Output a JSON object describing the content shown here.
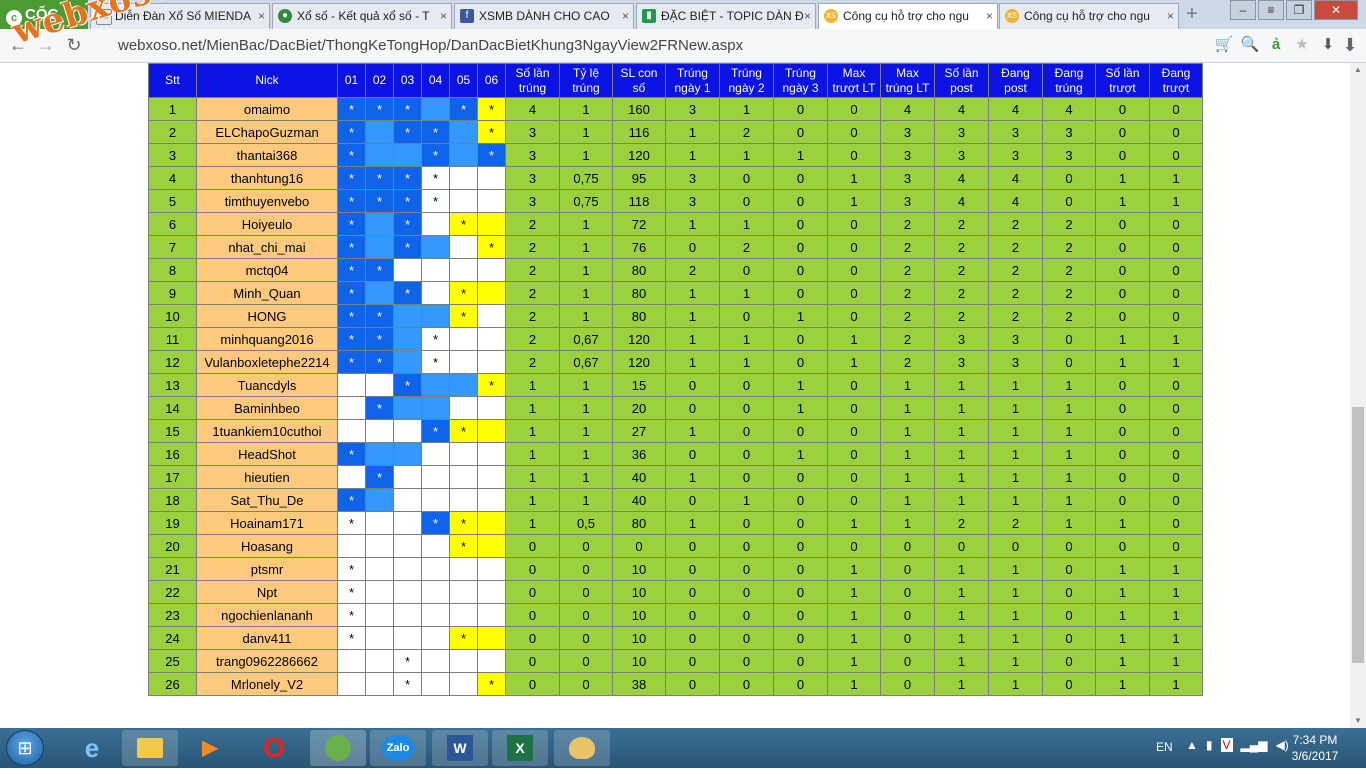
{
  "browser": {
    "brand": "CỐC CỐC",
    "tabs": [
      {
        "label": "Diễn Đàn Xổ Số MIENDA",
        "icon": "page-icon",
        "active": false
      },
      {
        "label": "Xổ số - Kết quả xổ số - T",
        "icon": "lottery-icon",
        "active": false
      },
      {
        "label": "XSMB DÀNH CHO CAO",
        "icon": "facebook-icon",
        "active": false
      },
      {
        "label": "ĐẶC BIỆT - TOPIC DÀN Đ",
        "icon": "doc-icon",
        "active": false
      },
      {
        "label": "Công cụ hỗ trợ cho ngu",
        "icon": "xs-icon",
        "active": true
      },
      {
        "label": "Công cụ hỗ trợ cho ngu",
        "icon": "xs-icon",
        "active": false
      }
    ],
    "url": "webxoso.net/MienBac/DacBiet/ThongKeTongHop/DanDacBietKhung3NgayView2FRNew.aspx"
  },
  "watermark": "webxoso.net",
  "table": {
    "headers": [
      "Stt",
      "Nick",
      "01",
      "02",
      "03",
      "04",
      "05",
      "06",
      "Số lần trúng",
      "Tỷ lệ trúng",
      "SL con số",
      "Trúng ngày 1",
      "Trúng ngày 2",
      "Trúng ngày 3",
      "Max trượt LT",
      "Max trúng LT",
      "Số lần post",
      "Đang post",
      "Đang trúng",
      "Số lần trượt",
      "Đang trượt"
    ],
    "day_cell_colors": {
      "db": "#0f63e9",
      "lb": "#3399ff",
      "yl": "#ffff00",
      "wh": "#ffffff"
    },
    "rows": [
      {
        "stt": "1",
        "nick": "omaimo",
        "days": [
          [
            "db",
            "*"
          ],
          [
            "db",
            "*"
          ],
          [
            "db",
            "*"
          ],
          [
            "lb",
            ""
          ],
          [
            "db",
            "*"
          ],
          [
            "yl",
            "*"
          ]
        ],
        "vals": [
          "4",
          "1",
          "160",
          "3",
          "1",
          "0",
          "0",
          "4",
          "4",
          "4",
          "4",
          "0",
          "0"
        ]
      },
      {
        "stt": "2",
        "nick": "ELChapoGuzman",
        "days": [
          [
            "db",
            "*"
          ],
          [
            "lb",
            ""
          ],
          [
            "db",
            "*"
          ],
          [
            "db",
            "*"
          ],
          [
            "lb",
            ""
          ],
          [
            "yl",
            "*"
          ]
        ],
        "vals": [
          "3",
          "1",
          "116",
          "1",
          "2",
          "0",
          "0",
          "3",
          "3",
          "3",
          "3",
          "0",
          "0"
        ]
      },
      {
        "stt": "3",
        "nick": "thantai368",
        "days": [
          [
            "db",
            "*"
          ],
          [
            "lb",
            ""
          ],
          [
            "lb",
            ""
          ],
          [
            "db",
            "*"
          ],
          [
            "lb",
            ""
          ],
          [
            "db",
            "*"
          ]
        ],
        "vals": [
          "3",
          "1",
          "120",
          "1",
          "1",
          "1",
          "0",
          "3",
          "3",
          "3",
          "3",
          "0",
          "0"
        ]
      },
      {
        "stt": "4",
        "nick": "thanhtung16",
        "days": [
          [
            "db",
            "*"
          ],
          [
            "db",
            "*"
          ],
          [
            "db",
            "*"
          ],
          [
            "wh",
            "*"
          ],
          [
            "wh",
            ""
          ],
          [
            "wh",
            ""
          ]
        ],
        "vals": [
          "3",
          "0,75",
          "95",
          "3",
          "0",
          "0",
          "1",
          "3",
          "4",
          "4",
          "0",
          "1",
          "1"
        ]
      },
      {
        "stt": "5",
        "nick": "timthuyenvebo",
        "days": [
          [
            "db",
            "*"
          ],
          [
            "db",
            "*"
          ],
          [
            "db",
            "*"
          ],
          [
            "wh",
            "*"
          ],
          [
            "wh",
            ""
          ],
          [
            "wh",
            ""
          ]
        ],
        "vals": [
          "3",
          "0,75",
          "118",
          "3",
          "0",
          "0",
          "1",
          "3",
          "4",
          "4",
          "0",
          "1",
          "1"
        ]
      },
      {
        "stt": "6",
        "nick": "Hoiyeulo",
        "days": [
          [
            "db",
            "*"
          ],
          [
            "lb",
            ""
          ],
          [
            "db",
            "*"
          ],
          [
            "wh",
            ""
          ],
          [
            "yl",
            "*"
          ],
          [
            "yl",
            ""
          ]
        ],
        "vals": [
          "2",
          "1",
          "72",
          "1",
          "1",
          "0",
          "0",
          "2",
          "2",
          "2",
          "2",
          "0",
          "0"
        ]
      },
      {
        "stt": "7",
        "nick": "nhat_chi_mai",
        "days": [
          [
            "db",
            "*"
          ],
          [
            "lb",
            ""
          ],
          [
            "db",
            "*"
          ],
          [
            "lb",
            ""
          ],
          [
            "wh",
            ""
          ],
          [
            "yl",
            "*"
          ]
        ],
        "vals": [
          "2",
          "1",
          "76",
          "0",
          "2",
          "0",
          "0",
          "2",
          "2",
          "2",
          "2",
          "0",
          "0"
        ]
      },
      {
        "stt": "8",
        "nick": "mctq04",
        "days": [
          [
            "db",
            "*"
          ],
          [
            "db",
            "*"
          ],
          [
            "wh",
            ""
          ],
          [
            "wh",
            ""
          ],
          [
            "wh",
            ""
          ],
          [
            "wh",
            ""
          ]
        ],
        "vals": [
          "2",
          "1",
          "80",
          "2",
          "0",
          "0",
          "0",
          "2",
          "2",
          "2",
          "2",
          "0",
          "0"
        ]
      },
      {
        "stt": "9",
        "nick": "Minh_Quan",
        "days": [
          [
            "db",
            "*"
          ],
          [
            "lb",
            ""
          ],
          [
            "db",
            "*"
          ],
          [
            "wh",
            ""
          ],
          [
            "yl",
            "*"
          ],
          [
            "yl",
            ""
          ]
        ],
        "vals": [
          "2",
          "1",
          "80",
          "1",
          "1",
          "0",
          "0",
          "2",
          "2",
          "2",
          "2",
          "0",
          "0"
        ]
      },
      {
        "stt": "10",
        "nick": "HONG",
        "days": [
          [
            "db",
            "*"
          ],
          [
            "db",
            "*"
          ],
          [
            "lb",
            ""
          ],
          [
            "lb",
            ""
          ],
          [
            "yl",
            "*"
          ],
          [
            "wh",
            ""
          ]
        ],
        "vals": [
          "2",
          "1",
          "80",
          "1",
          "0",
          "1",
          "0",
          "2",
          "2",
          "2",
          "2",
          "0",
          "0"
        ]
      },
      {
        "stt": "11",
        "nick": "minhquang2016",
        "days": [
          [
            "db",
            "*"
          ],
          [
            "db",
            "*"
          ],
          [
            "lb",
            ""
          ],
          [
            "wh",
            "*"
          ],
          [
            "wh",
            ""
          ],
          [
            "wh",
            ""
          ]
        ],
        "vals": [
          "2",
          "0,67",
          "120",
          "1",
          "1",
          "0",
          "1",
          "2",
          "3",
          "3",
          "0",
          "1",
          "1"
        ]
      },
      {
        "stt": "12",
        "nick": "Vulanboxletephe2214",
        "days": [
          [
            "db",
            "*"
          ],
          [
            "db",
            "*"
          ],
          [
            "lb",
            ""
          ],
          [
            "wh",
            "*"
          ],
          [
            "wh",
            ""
          ],
          [
            "wh",
            ""
          ]
        ],
        "vals": [
          "2",
          "0,67",
          "120",
          "1",
          "1",
          "0",
          "1",
          "2",
          "3",
          "3",
          "0",
          "1",
          "1"
        ]
      },
      {
        "stt": "13",
        "nick": "Tuancdyls",
        "days": [
          [
            "wh",
            ""
          ],
          [
            "wh",
            ""
          ],
          [
            "db",
            "*"
          ],
          [
            "lb",
            ""
          ],
          [
            "lb",
            ""
          ],
          [
            "yl",
            "*"
          ]
        ],
        "vals": [
          "1",
          "1",
          "15",
          "0",
          "0",
          "1",
          "0",
          "1",
          "1",
          "1",
          "1",
          "0",
          "0"
        ]
      },
      {
        "stt": "14",
        "nick": "Baminhbeo",
        "days": [
          [
            "wh",
            ""
          ],
          [
            "db",
            "*"
          ],
          [
            "lb",
            ""
          ],
          [
            "lb",
            ""
          ],
          [
            "wh",
            ""
          ],
          [
            "wh",
            ""
          ]
        ],
        "vals": [
          "1",
          "1",
          "20",
          "0",
          "0",
          "1",
          "0",
          "1",
          "1",
          "1",
          "1",
          "0",
          "0"
        ]
      },
      {
        "stt": "15",
        "nick": "1tuankiem10cuthoi",
        "days": [
          [
            "wh",
            ""
          ],
          [
            "wh",
            ""
          ],
          [
            "wh",
            ""
          ],
          [
            "db",
            "*"
          ],
          [
            "yl",
            "*"
          ],
          [
            "yl",
            ""
          ]
        ],
        "vals": [
          "1",
          "1",
          "27",
          "1",
          "0",
          "0",
          "0",
          "1",
          "1",
          "1",
          "1",
          "0",
          "0"
        ]
      },
      {
        "stt": "16",
        "nick": "HeadShot",
        "days": [
          [
            "db",
            "*"
          ],
          [
            "lb",
            ""
          ],
          [
            "lb",
            ""
          ],
          [
            "wh",
            ""
          ],
          [
            "wh",
            ""
          ],
          [
            "wh",
            ""
          ]
        ],
        "vals": [
          "1",
          "1",
          "36",
          "0",
          "0",
          "1",
          "0",
          "1",
          "1",
          "1",
          "1",
          "0",
          "0"
        ]
      },
      {
        "stt": "17",
        "nick": "hieutien",
        "days": [
          [
            "wh",
            ""
          ],
          [
            "db",
            "*"
          ],
          [
            "wh",
            ""
          ],
          [
            "wh",
            ""
          ],
          [
            "wh",
            ""
          ],
          [
            "wh",
            ""
          ]
        ],
        "vals": [
          "1",
          "1",
          "40",
          "1",
          "0",
          "0",
          "0",
          "1",
          "1",
          "1",
          "1",
          "0",
          "0"
        ]
      },
      {
        "stt": "18",
        "nick": "Sat_Thu_De",
        "days": [
          [
            "db",
            "*"
          ],
          [
            "lb",
            ""
          ],
          [
            "wh",
            ""
          ],
          [
            "wh",
            ""
          ],
          [
            "wh",
            ""
          ],
          [
            "wh",
            ""
          ]
        ],
        "vals": [
          "1",
          "1",
          "40",
          "0",
          "1",
          "0",
          "0",
          "1",
          "1",
          "1",
          "1",
          "0",
          "0"
        ]
      },
      {
        "stt": "19",
        "nick": "Hoainam171",
        "days": [
          [
            "wh",
            "*"
          ],
          [
            "wh",
            ""
          ],
          [
            "wh",
            ""
          ],
          [
            "db",
            "*"
          ],
          [
            "yl",
            "*"
          ],
          [
            "yl",
            ""
          ]
        ],
        "vals": [
          "1",
          "0,5",
          "80",
          "1",
          "0",
          "0",
          "1",
          "1",
          "2",
          "2",
          "1",
          "1",
          "0"
        ]
      },
      {
        "stt": "20",
        "nick": "Hoasang",
        "days": [
          [
            "wh",
            ""
          ],
          [
            "wh",
            ""
          ],
          [
            "wh",
            ""
          ],
          [
            "wh",
            ""
          ],
          [
            "yl",
            "*"
          ],
          [
            "yl",
            ""
          ]
        ],
        "vals": [
          "0",
          "0",
          "0",
          "0",
          "0",
          "0",
          "0",
          "0",
          "0",
          "0",
          "0",
          "0",
          "0"
        ]
      },
      {
        "stt": "21",
        "nick": "ptsmr",
        "days": [
          [
            "wh",
            "*"
          ],
          [
            "wh",
            ""
          ],
          [
            "wh",
            ""
          ],
          [
            "wh",
            ""
          ],
          [
            "wh",
            ""
          ],
          [
            "wh",
            ""
          ]
        ],
        "vals": [
          "0",
          "0",
          "10",
          "0",
          "0",
          "0",
          "1",
          "0",
          "1",
          "1",
          "0",
          "1",
          "1"
        ]
      },
      {
        "stt": "22",
        "nick": "Npt",
        "days": [
          [
            "wh",
            "*"
          ],
          [
            "wh",
            ""
          ],
          [
            "wh",
            ""
          ],
          [
            "wh",
            ""
          ],
          [
            "wh",
            ""
          ],
          [
            "wh",
            ""
          ]
        ],
        "vals": [
          "0",
          "0",
          "10",
          "0",
          "0",
          "0",
          "1",
          "0",
          "1",
          "1",
          "0",
          "1",
          "1"
        ]
      },
      {
        "stt": "23",
        "nick": "ngochienlananh",
        "days": [
          [
            "wh",
            "*"
          ],
          [
            "wh",
            ""
          ],
          [
            "wh",
            ""
          ],
          [
            "wh",
            ""
          ],
          [
            "wh",
            ""
          ],
          [
            "wh",
            ""
          ]
        ],
        "vals": [
          "0",
          "0",
          "10",
          "0",
          "0",
          "0",
          "1",
          "0",
          "1",
          "1",
          "0",
          "1",
          "1"
        ]
      },
      {
        "stt": "24",
        "nick": "danv411",
        "days": [
          [
            "wh",
            "*"
          ],
          [
            "wh",
            ""
          ],
          [
            "wh",
            ""
          ],
          [
            "wh",
            ""
          ],
          [
            "yl",
            "*"
          ],
          [
            "yl",
            ""
          ]
        ],
        "vals": [
          "0",
          "0",
          "10",
          "0",
          "0",
          "0",
          "1",
          "0",
          "1",
          "1",
          "0",
          "1",
          "1"
        ]
      },
      {
        "stt": "25",
        "nick": "trang0962286662",
        "days": [
          [
            "wh",
            ""
          ],
          [
            "wh",
            ""
          ],
          [
            "wh",
            "*"
          ],
          [
            "wh",
            ""
          ],
          [
            "wh",
            ""
          ],
          [
            "wh",
            ""
          ]
        ],
        "vals": [
          "0",
          "0",
          "10",
          "0",
          "0",
          "0",
          "1",
          "0",
          "1",
          "1",
          "0",
          "1",
          "1"
        ]
      },
      {
        "stt": "26",
        "nick": "Mrlonely_V2",
        "days": [
          [
            "wh",
            ""
          ],
          [
            "wh",
            ""
          ],
          [
            "wh",
            "*"
          ],
          [
            "wh",
            ""
          ],
          [
            "wh",
            ""
          ],
          [
            "yl",
            "*"
          ]
        ],
        "vals": [
          "0",
          "0",
          "38",
          "0",
          "0",
          "0",
          "1",
          "0",
          "1",
          "1",
          "0",
          "1",
          "1"
        ]
      }
    ]
  },
  "taskbar": {
    "apps": [
      {
        "name": "ie-icon",
        "label": "e"
      },
      {
        "name": "explorer-icon",
        "label": ""
      },
      {
        "name": "media-player-icon",
        "label": "▶"
      },
      {
        "name": "opera-icon",
        "label": "O"
      },
      {
        "name": "coccoc-icon",
        "label": ""
      },
      {
        "name": "zalo-icon",
        "label": "Zalo"
      },
      {
        "name": "word-icon",
        "label": "W"
      },
      {
        "name": "excel-icon",
        "label": "X"
      },
      {
        "name": "paint-icon",
        "label": ""
      }
    ],
    "lang": "EN",
    "time": "7:34 PM",
    "date": "3/6/2017"
  }
}
